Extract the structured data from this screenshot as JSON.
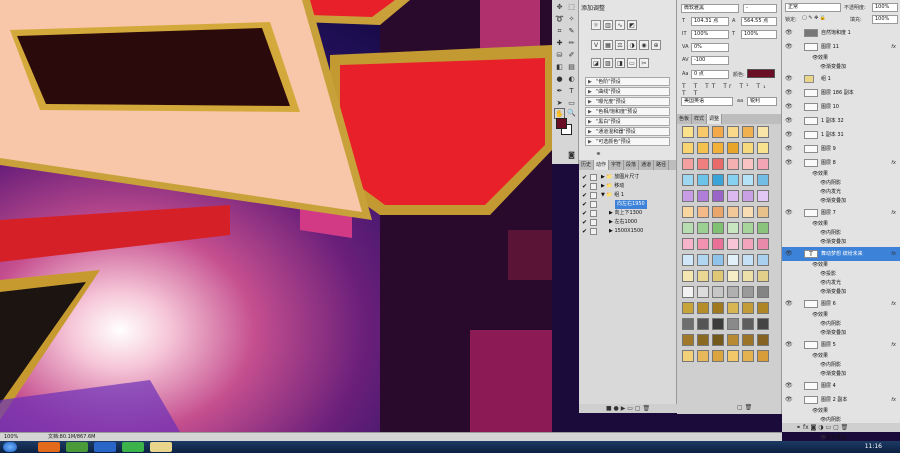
{
  "adjustments": {
    "title": "添加调整",
    "presets": [
      "\"色阶\"预设",
      "\"曲线\"预设",
      "\"曝光度\"预设",
      "\"色相/饱和度\"预设",
      "\"黑白\"预设",
      "\"通道混和器\"预设",
      "\"可选颜色\"预设"
    ]
  },
  "actions": {
    "tabs": [
      "历史",
      "动作",
      "字符",
      "段落",
      "通道",
      "路径"
    ],
    "items": [
      {
        "label": "放图片尺寸",
        "level": 1
      },
      {
        "label": "移动",
        "level": 1
      },
      {
        "label": "组 1",
        "level": 1
      },
      {
        "label": "向左右1950",
        "level": 2,
        "selected": true
      },
      {
        "label": "向上下1300",
        "level": 2
      },
      {
        "label": "左右1000",
        "level": 2
      },
      {
        "label": "1500X1500",
        "level": 2
      }
    ]
  },
  "character": {
    "font_family": "微软雅黑",
    "font_style": "-",
    "font_size": "104.31 点",
    "leading": "564.55 点",
    "tracking": "0%",
    "kerning": "-100",
    "scale_v": "100%",
    "scale_h": "100%",
    "baseline": "0 点",
    "color_label": "颜色:",
    "language": "美国英语",
    "antialias": "锐利"
  },
  "styles": {
    "tabs": [
      "色板",
      "样式",
      "调整"
    ]
  },
  "layers": {
    "blend_mode": "正常",
    "opacity_label": "不透明度:",
    "opacity": "100%",
    "lock_label": "锁定:",
    "fill_label": "填充:",
    "fill": "100%",
    "rows": [
      {
        "name": "自然饱和度 1",
        "kind": "adj"
      },
      {
        "name": "图层 11",
        "fx": true
      },
      {
        "name": "效果",
        "kind": "sub"
      },
      {
        "name": "渐变叠加",
        "kind": "sub2"
      },
      {
        "name": "组 1",
        "kind": "group"
      },
      {
        "name": "图层 186 副本"
      },
      {
        "name": "图层 10"
      },
      {
        "name": "1 副本 32"
      },
      {
        "name": "1 副本 31"
      },
      {
        "name": "图层 9"
      },
      {
        "name": "图层 8",
        "fx": true
      },
      {
        "name": "效果",
        "kind": "sub"
      },
      {
        "name": "内阴影",
        "kind": "sub2"
      },
      {
        "name": "内发光",
        "kind": "sub2"
      },
      {
        "name": "渐变叠加",
        "kind": "sub2"
      },
      {
        "name": "图层 7",
        "fx": true
      },
      {
        "name": "效果",
        "kind": "sub"
      },
      {
        "name": "内阴影",
        "kind": "sub2"
      },
      {
        "name": "渐变叠加",
        "kind": "sub2"
      },
      {
        "name": "舞动梦想 缤纷未来",
        "fx": true,
        "selected": true,
        "kind": "text"
      },
      {
        "name": "效果",
        "kind": "sub"
      },
      {
        "name": "投影",
        "kind": "sub2"
      },
      {
        "name": "内发光",
        "kind": "sub2"
      },
      {
        "name": "渐变叠加",
        "kind": "sub2"
      },
      {
        "name": "图层 6",
        "fx": true
      },
      {
        "name": "效果",
        "kind": "sub"
      },
      {
        "name": "内阴影",
        "kind": "sub2"
      },
      {
        "name": "渐变叠加",
        "kind": "sub2"
      },
      {
        "name": "图层 5",
        "fx": true
      },
      {
        "name": "效果",
        "kind": "sub"
      },
      {
        "name": "内阴影",
        "kind": "sub2"
      },
      {
        "name": "渐变叠加",
        "kind": "sub2"
      },
      {
        "name": "图层 4"
      },
      {
        "name": "图层 2 副本",
        "fx": true
      },
      {
        "name": "效果",
        "kind": "sub"
      },
      {
        "name": "内阴影",
        "kind": "sub2"
      },
      {
        "name": "内发光",
        "kind": "sub2"
      },
      {
        "name": "渐变叠加",
        "kind": "sub2"
      },
      {
        "name": "图层 41 副本 2",
        "fx": true
      }
    ]
  },
  "status": {
    "zoom": "100%",
    "doc_info": "文档:80.1M/867.6M"
  },
  "taskbar": {
    "time": "11:16"
  },
  "colors": {
    "fg_swatch": "#6a0e26",
    "selection": "#3c82d8",
    "canvas_red": "#e8202a",
    "gold": "#d9a935"
  }
}
